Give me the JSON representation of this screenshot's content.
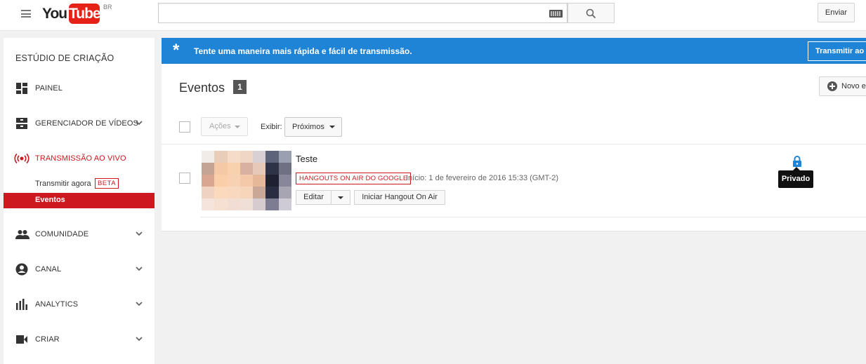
{
  "header": {
    "logo_you": "You",
    "logo_tube": "Tube",
    "logo_region": "BR",
    "search_value": "",
    "upload_label": "Enviar"
  },
  "sidebar": {
    "title": "ESTÚDIO DE CRIAÇÃO",
    "items": [
      {
        "label": "PAINEL",
        "icon": "dashboard-icon"
      },
      {
        "label": "GERENCIADOR DE VÍDEOS",
        "icon": "video-manager-icon"
      },
      {
        "label": "TRANSMISSÃO AO VIVO",
        "icon": "live-broadcast-icon"
      },
      {
        "label": "COMUNIDADE",
        "icon": "community-icon"
      },
      {
        "label": "CANAL",
        "icon": "channel-icon"
      },
      {
        "label": "ANALYTICS",
        "icon": "analytics-icon"
      },
      {
        "label": "CRIAR",
        "icon": "create-icon"
      }
    ],
    "live_sub": [
      {
        "label": "Transmitir agora",
        "badge": "BETA"
      },
      {
        "label": "Eventos"
      }
    ]
  },
  "banner": {
    "text": "Tente uma maneira mais rápida e fácil de transmissão.",
    "cta": "Transmitir ao vivo",
    "color": "#1f84d6"
  },
  "events": {
    "title": "Eventos",
    "count": "1",
    "new_label": "Novo evento",
    "actions_label": "Ações",
    "show_label": "Exibir:",
    "filter_selected": "Próximos",
    "rows": [
      {
        "title": "Teste",
        "badge": "HANGOUTS ON AIR DO GOOGLE",
        "start": "Início: 1 de fevereiro de 2016 15:33 (GMT-2)",
        "edit_label": "Editar",
        "hangout_label": "Iniciar Hangout On Air",
        "privacy": "Privado"
      }
    ]
  },
  "colors": {
    "brand_red": "#cc181e",
    "privacy_blue": "#1f84d6"
  }
}
